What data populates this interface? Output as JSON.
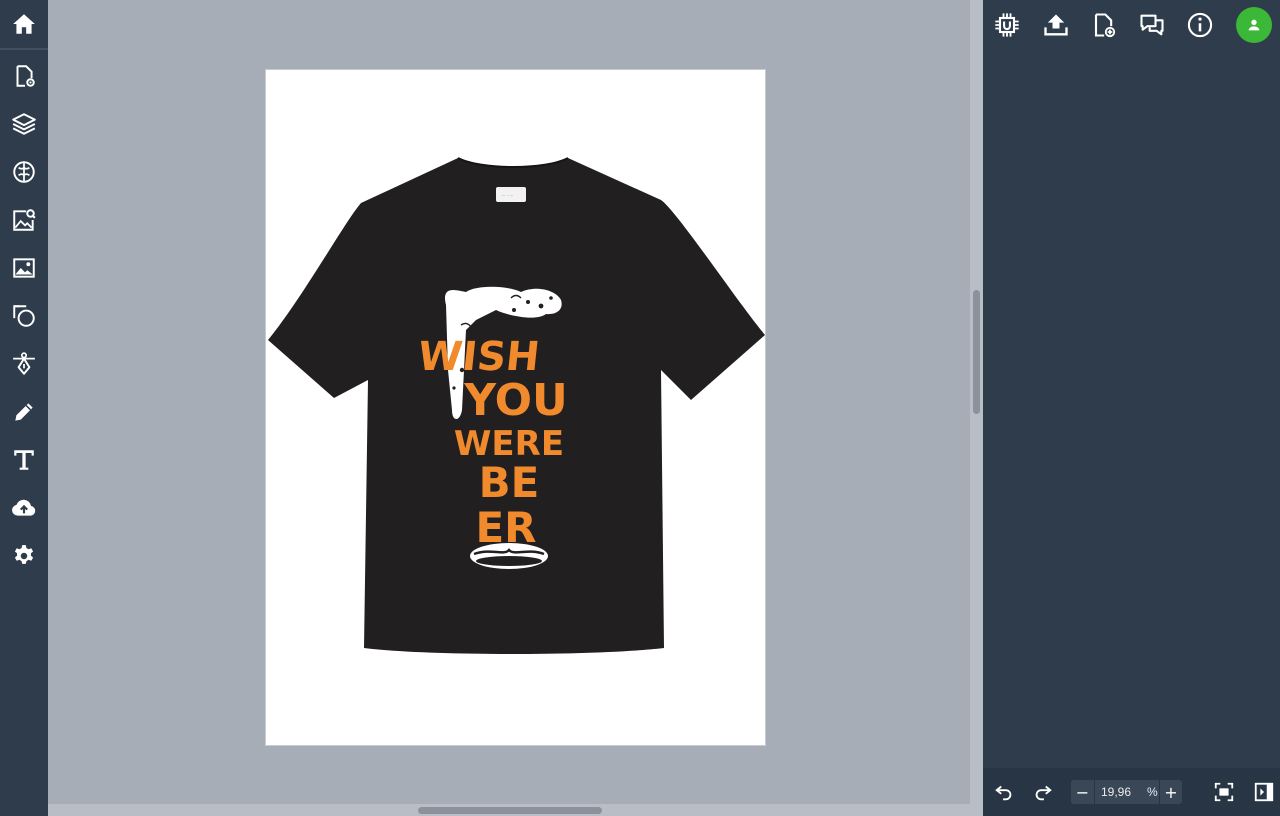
{
  "left_toolbar": {
    "items": [
      {
        "name": "home-icon"
      },
      {
        "name": "page-settings-icon"
      },
      {
        "name": "layers-icon"
      },
      {
        "name": "ai-brain-icon"
      },
      {
        "name": "image-search-icon"
      },
      {
        "name": "image-icon"
      },
      {
        "name": "shapes-icon"
      },
      {
        "name": "vector-pen-icon"
      },
      {
        "name": "pencil-icon"
      },
      {
        "name": "text-icon"
      },
      {
        "name": "cloud-upload-icon"
      },
      {
        "name": "gear-icon"
      }
    ]
  },
  "right_toolbar": {
    "items": [
      {
        "name": "chip-icon"
      },
      {
        "name": "upload-icon"
      },
      {
        "name": "add-page-icon"
      },
      {
        "name": "comments-icon"
      },
      {
        "name": "info-icon"
      },
      {
        "name": "user-avatar-icon"
      }
    ]
  },
  "canvas": {
    "design_text_lines": [
      "WISH",
      "YOU",
      "WERE",
      "BE",
      "ER"
    ],
    "shirt_color": "#221f20",
    "text_color": "#f08a2c",
    "foam_color": "#ffffff"
  },
  "zoom": {
    "value": "19,96",
    "unit": "%",
    "minus_label": "−",
    "plus_label": "+"
  },
  "colors": {
    "panel_bg": "#2f3c4b",
    "canvas_bg": "#a6adb7",
    "avatar_bg": "#3cb838"
  }
}
